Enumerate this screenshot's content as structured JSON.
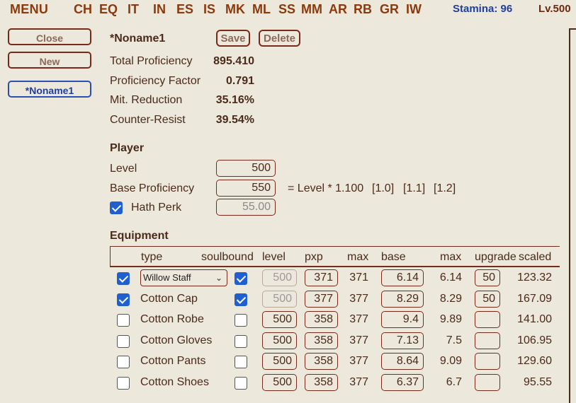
{
  "nav": {
    "menu": "MENU",
    "items": [
      "CH",
      "EQ",
      "IT",
      "IN",
      "ES",
      "IS",
      "MK",
      "ML",
      "SS",
      "MM",
      "AR",
      "RB",
      "GR",
      "IW"
    ],
    "stamina": "Stamina: 96",
    "level": "Lv.500"
  },
  "sidebar": {
    "close": "Close",
    "new": "New",
    "build": "*Noname1"
  },
  "build": {
    "name": "*Noname1",
    "save": "Save",
    "delete": "Delete"
  },
  "stats": [
    {
      "label": "Total Proficiency",
      "value": "895.410"
    },
    {
      "label": "Proficiency Factor",
      "value": "0.791"
    },
    {
      "label": "Mit. Reduction",
      "value": "35.16%"
    },
    {
      "label": "Counter-Resist",
      "value": "39.54%"
    }
  ],
  "player": {
    "heading": "Player",
    "level_label": "Level",
    "level_value": "500",
    "base_label": "Base Proficiency",
    "base_value": "550",
    "formula": "= Level * 1.100",
    "mult1": "[1.0]",
    "mult2": "[1.1]",
    "mult3": "[1.2]",
    "hath_label": "Hath Perk",
    "hath_checked": true,
    "hath_value": "55.00"
  },
  "equipment": {
    "heading": "Equipment",
    "columns": [
      "type",
      "soulbound",
      "level",
      "pxp",
      "max",
      "base",
      "max",
      "upgrade",
      "scaled"
    ],
    "rows": [
      {
        "checked": true,
        "type": "Willow Staff",
        "select": true,
        "soulbound": true,
        "level": "500",
        "level_disabled": true,
        "pxp": "371",
        "max": "371",
        "base": "6.14",
        "max2": "6.14",
        "upgrade": "50",
        "scaled": "123.32"
      },
      {
        "checked": true,
        "type": "Cotton Cap",
        "select": false,
        "soulbound": true,
        "level": "500",
        "level_disabled": true,
        "pxp": "377",
        "max": "377",
        "base": "8.29",
        "max2": "8.29",
        "upgrade": "50",
        "scaled": "167.09"
      },
      {
        "checked": false,
        "type": "Cotton Robe",
        "select": false,
        "soulbound": false,
        "level": "500",
        "level_disabled": false,
        "pxp": "358",
        "max": "377",
        "base": "9.4",
        "max2": "9.89",
        "upgrade": "",
        "scaled": "141.00"
      },
      {
        "checked": false,
        "type": "Cotton Gloves",
        "select": false,
        "soulbound": false,
        "level": "500",
        "level_disabled": false,
        "pxp": "358",
        "max": "377",
        "base": "7.13",
        "max2": "7.5",
        "upgrade": "",
        "scaled": "106.95"
      },
      {
        "checked": false,
        "type": "Cotton Pants",
        "select": false,
        "soulbound": false,
        "level": "500",
        "level_disabled": false,
        "pxp": "358",
        "max": "377",
        "base": "8.64",
        "max2": "9.09",
        "upgrade": "",
        "scaled": "129.60"
      },
      {
        "checked": false,
        "type": "Cotton Shoes",
        "select": false,
        "soulbound": false,
        "level": "500",
        "level_disabled": false,
        "pxp": "358",
        "max": "377",
        "base": "6.37",
        "max2": "6.7",
        "upgrade": "",
        "scaled": "95.55"
      }
    ]
  },
  "colors": {
    "nav": "#8b3a0e",
    "stamina": "#1f3f9f",
    "checkbox": "#1f5fcf",
    "border": "#7a2a1a",
    "background": "#ede8dc"
  }
}
